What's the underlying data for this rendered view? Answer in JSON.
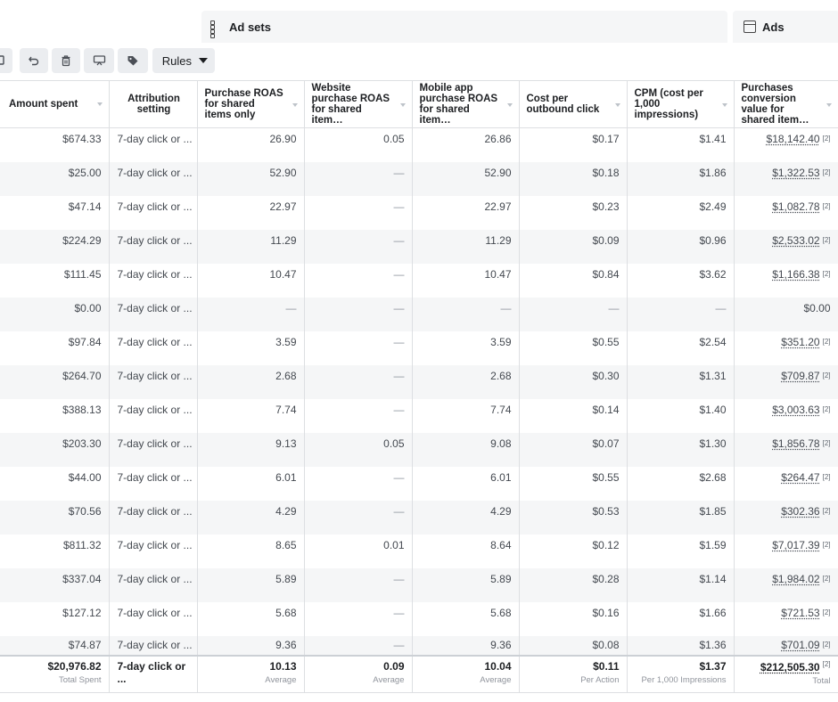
{
  "tabs": {
    "adsets_label": "Ad sets",
    "ads_label": "Ads"
  },
  "toolbar": {
    "rules_label": "Rules",
    "icons": [
      "duplicate-icon",
      "undo-icon",
      "delete-icon",
      "preview-icon",
      "tag-icon"
    ]
  },
  "columns": [
    "Amount spent",
    "Attribution setting",
    "Purchase ROAS for shared items only",
    "Website purchase ROAS for shared item…",
    "Mobile app purchase ROAS for shared item…",
    "Cost per outbound click",
    "CPM (cost per 1,000 impressions)",
    "Purchases conversion value for shared item…"
  ],
  "rows": [
    [
      "$674.33",
      "7-day click or ...",
      "26.90",
      "0.05",
      "26.86",
      "$0.17",
      "$1.41",
      "$18,142.40"
    ],
    [
      "$25.00",
      "7-day click or ...",
      "52.90",
      "—",
      "52.90",
      "$0.18",
      "$1.86",
      "$1,322.53"
    ],
    [
      "$47.14",
      "7-day click or ...",
      "22.97",
      "—",
      "22.97",
      "$0.23",
      "$2.49",
      "$1,082.78"
    ],
    [
      "$224.29",
      "7-day click or ...",
      "11.29",
      "—",
      "11.29",
      "$0.09",
      "$0.96",
      "$2,533.02"
    ],
    [
      "$111.45",
      "7-day click or ...",
      "10.47",
      "—",
      "10.47",
      "$0.84",
      "$3.62",
      "$1,166.38"
    ],
    [
      "$0.00",
      "7-day click or ...",
      "—",
      "—",
      "—",
      "—",
      "—",
      "$0.00"
    ],
    [
      "$97.84",
      "7-day click or ...",
      "3.59",
      "—",
      "3.59",
      "$0.55",
      "$2.54",
      "$351.20"
    ],
    [
      "$264.70",
      "7-day click or ...",
      "2.68",
      "—",
      "2.68",
      "$0.30",
      "$1.31",
      "$709.87"
    ],
    [
      "$388.13",
      "7-day click or ...",
      "7.74",
      "—",
      "7.74",
      "$0.14",
      "$1.40",
      "$3,003.63"
    ],
    [
      "$203.30",
      "7-day click or ...",
      "9.13",
      "0.05",
      "9.08",
      "$0.07",
      "$1.30",
      "$1,856.78"
    ],
    [
      "$44.00",
      "7-day click or ...",
      "6.01",
      "—",
      "6.01",
      "$0.55",
      "$2.68",
      "$264.47"
    ],
    [
      "$70.56",
      "7-day click or ...",
      "4.29",
      "—",
      "4.29",
      "$0.53",
      "$1.85",
      "$302.36"
    ],
    [
      "$811.32",
      "7-day click or ...",
      "8.65",
      "0.01",
      "8.64",
      "$0.12",
      "$1.59",
      "$7,017.39"
    ],
    [
      "$337.04",
      "7-day click or ...",
      "5.89",
      "—",
      "5.89",
      "$0.28",
      "$1.14",
      "$1,984.02"
    ],
    [
      "$127.12",
      "7-day click or ...",
      "5.68",
      "—",
      "5.68",
      "$0.16",
      "$1.66",
      "$721.53"
    ],
    [
      "$74.87",
      "7-day click or ...",
      "9.36",
      "—",
      "9.36",
      "$0.08",
      "$1.36",
      "$701.09"
    ]
  ],
  "link_marker": "[2]",
  "totals": [
    {
      "value": "$20,976.82",
      "label": "Total Spent"
    },
    {
      "value": "7-day click or ...",
      "label": ""
    },
    {
      "value": "10.13",
      "label": "Average"
    },
    {
      "value": "0.09",
      "label": "Average"
    },
    {
      "value": "10.04",
      "label": "Average"
    },
    {
      "value": "$0.11",
      "label": "Per Action"
    },
    {
      "value": "$1.37",
      "label": "Per 1,000 Impressions"
    },
    {
      "value": "$212,505.30",
      "label": "Total"
    }
  ]
}
